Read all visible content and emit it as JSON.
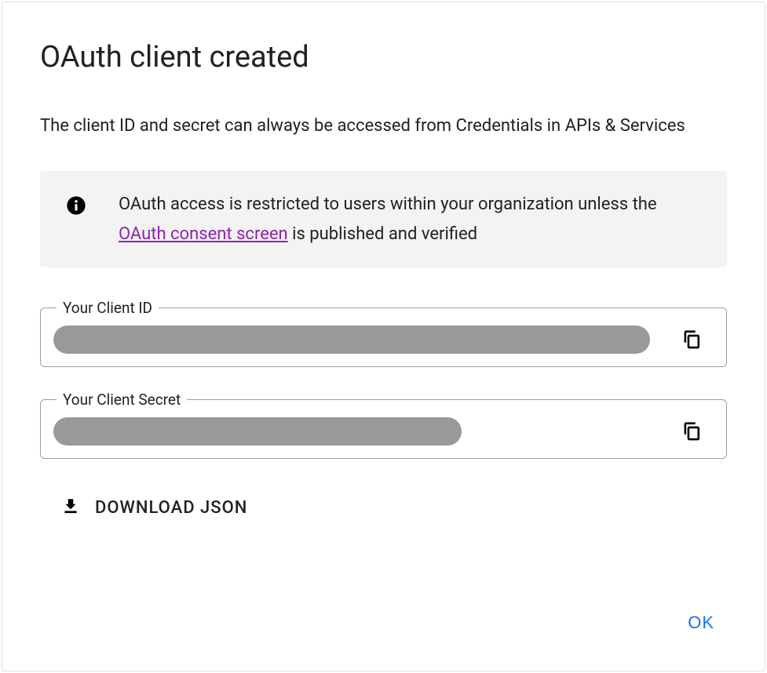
{
  "dialog": {
    "title": "OAuth client created",
    "subtitle": "The client ID and secret can always be accessed from Credentials in APIs & Services"
  },
  "notice": {
    "text_before": "OAuth access is restricted to users within your organization unless the ",
    "link": "OAuth consent screen",
    "text_after": " is published and verified"
  },
  "fields": {
    "client_id": {
      "label": "Your Client ID",
      "value": ""
    },
    "client_secret": {
      "label": "Your Client Secret",
      "value": ""
    }
  },
  "download": {
    "label": "DOWNLOAD JSON"
  },
  "actions": {
    "ok": "OK"
  }
}
